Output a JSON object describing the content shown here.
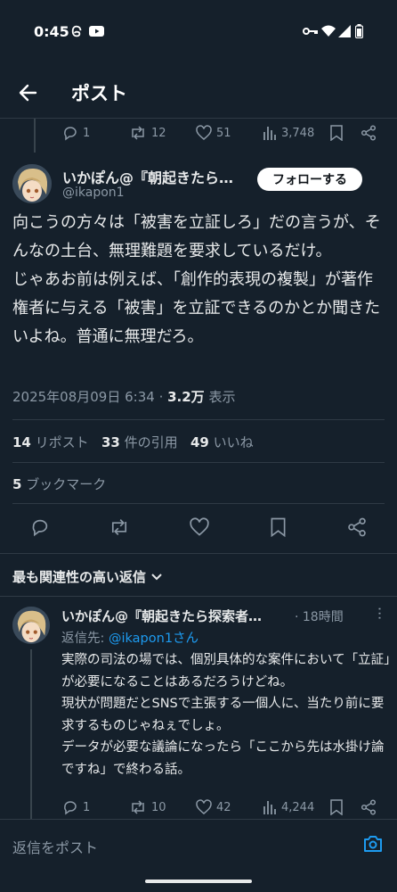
{
  "status_bar": {
    "time": "0:45"
  },
  "header": {
    "title": "ポスト"
  },
  "prev_post_actions": {
    "replies": "1",
    "reposts": "12",
    "likes": "51",
    "views": "3,748"
  },
  "post": {
    "author_name": "いかぽん@『朝起きたら…",
    "handle": "@ikapon1",
    "follow_label": "フォローする",
    "body": "向こうの方々は「被害を立証しろ」だの言うが、そんなの土台、無理難題を要求しているだけ。\nじゃあお前は例えば、「創作的表現の複製」が著作権者に与える「被害」を立証できるのかとか聞きたいよね。普通に無理だろ。",
    "timestamp": "2025年08月09日 6:34 · ",
    "views_count": "3.2万",
    "views_label": " 表示",
    "reposts_count": "14",
    "reposts_label": "リポスト",
    "quotes_count": "33",
    "quotes_label": "件の引用",
    "likes_count": "49",
    "likes_label": "いいね",
    "bookmarks_count": "5",
    "bookmarks_label": "ブックマーク"
  },
  "sort": {
    "label": "最も関連性の高い返信"
  },
  "reply": {
    "author_name": "いかぽん@『朝起きたら探索者…",
    "time": "· 18時間",
    "reply_to_prefix": "返信先: ",
    "reply_to_handle": "@ikapon1さん",
    "body": "実際の司法の場では、個別具体的な案件において「立証」が必要になることはあるだろうけどね。\n現状が問題だとSNSで主張する一個人に、当たり前に要求するものじゃねぇでしょ。\nデータが必要な議論になったら「ここから先は水掛け論ですね」で終わる話。",
    "replies": "1",
    "reposts": "10",
    "likes": "42",
    "views": "4,244"
  },
  "compose": {
    "placeholder": "返信をポスト"
  },
  "colors": {
    "background": "#15202b",
    "accent": "#1d9bf0",
    "muted": "#8b98a5",
    "text": "#e7e9ea"
  }
}
